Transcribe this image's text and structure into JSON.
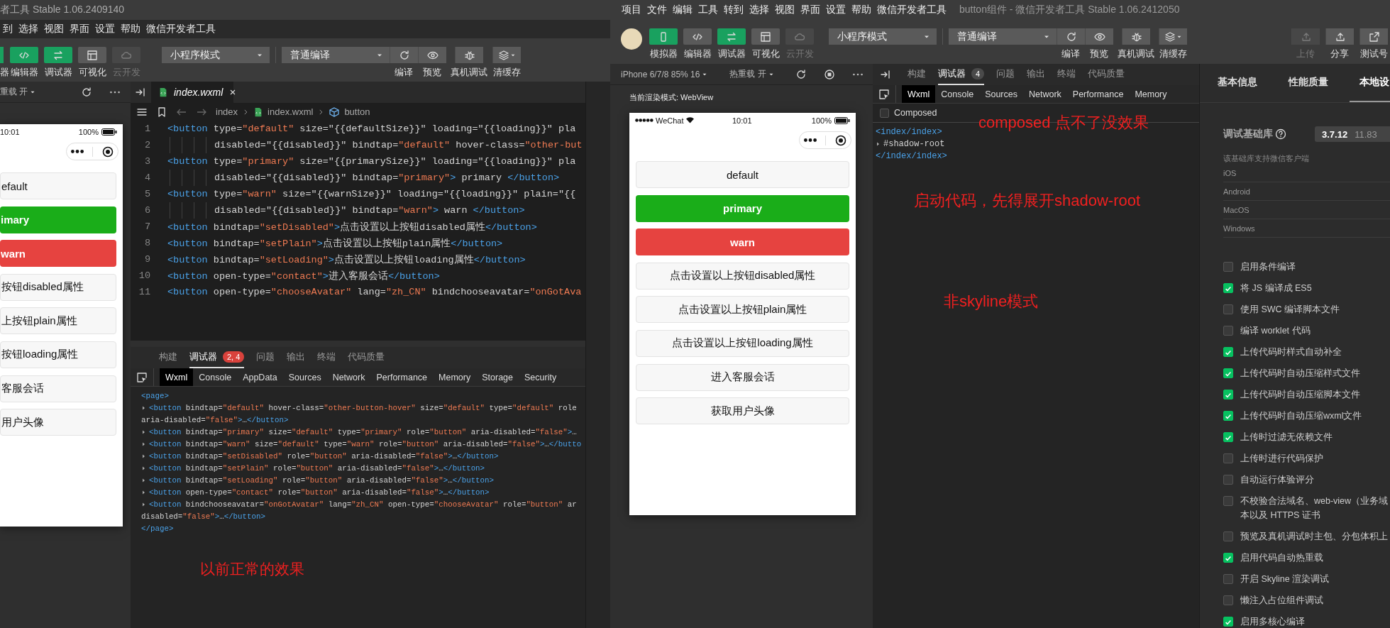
{
  "left_window": {
    "title": "者工具 Stable 1.06.2409140",
    "menu": [
      "到",
      "选择",
      "视图",
      "界面",
      "设置",
      "帮助",
      "微信开发者工具"
    ],
    "tools": [
      {
        "label": "器",
        "kind": "simulator",
        "active": true,
        "disabled": false
      },
      {
        "label": "编辑器",
        "kind": "editor",
        "active": true,
        "disabled": false
      },
      {
        "label": "调试器",
        "kind": "debugger",
        "active": true,
        "disabled": false
      },
      {
        "label": "可视化",
        "kind": "visual",
        "active": false,
        "disabled": false
      },
      {
        "label": "云开发",
        "kind": "cloud",
        "active": false,
        "disabled": true
      }
    ],
    "mode_select": "小程序模式",
    "compile_select": "普通编译",
    "actions": [
      {
        "label": "编译",
        "kind": "refresh"
      },
      {
        "label": "预览",
        "kind": "preview"
      },
      {
        "label": "真机调试",
        "kind": "debug"
      },
      {
        "label": "清缓存",
        "kind": "clear"
      }
    ],
    "sim_header": {
      "hot_reload": "重载 开"
    },
    "phone": {
      "time": "10:01",
      "battery": "100%",
      "buttons": [
        {
          "label": "efault",
          "kind": "default"
        },
        {
          "label": "imary",
          "kind": "primary"
        },
        {
          "label": "warn",
          "kind": "warn"
        },
        {
          "label": "按钮disabled属性",
          "kind": "default"
        },
        {
          "label": "上按钮plain属性",
          "kind": "default"
        },
        {
          "label": "按钮loading属性",
          "kind": "default"
        },
        {
          "label": "客服会话",
          "kind": "default"
        },
        {
          "label": "用户头像",
          "kind": "default"
        }
      ]
    },
    "editor": {
      "tab": "index.wxml",
      "breadcrumb": [
        "index",
        "index.wxml",
        "button"
      ],
      "lines": [
        {
          "number": "1",
          "code": "<button type=\"default\" size=\"{{defaultSize}}\" loading=\"{{loading}}\" pla",
          "wrapped": false
        },
        {
          "number": "2",
          "code": "disabled=\"{{disabled}}\" bindtap=\"default\" hover-class=\"other-but",
          "wrapped": true
        },
        {
          "number": "3",
          "code": "<button type=\"primary\" size=\"{{primarySize}}\" loading=\"{{loading}}\" pla",
          "wrapped": false
        },
        {
          "number": "4",
          "code": "disabled=\"{{disabled}}\" bindtap=\"primary\"> primary </button>",
          "wrapped": true
        },
        {
          "number": "5",
          "code": "<button type=\"warn\" size=\"{{warnSize}}\" loading=\"{{loading}}\" plain=\"{{",
          "wrapped": false
        },
        {
          "number": "6",
          "code": "disabled=\"{{disabled}}\" bindtap=\"warn\"> warn </button>",
          "wrapped": true
        },
        {
          "number": "7",
          "code": "<button bindtap=\"setDisabled\">点击设置以上按钮disabled属性</button>",
          "wrapped": false
        },
        {
          "number": "8",
          "code": "<button bindtap=\"setPlain\">点击设置以上按钮plain属性</button>",
          "wrapped": false
        },
        {
          "number": "9",
          "code": "<button bindtap=\"setLoading\">点击设置以上按钮loading属性</button>",
          "wrapped": false
        },
        {
          "number": "10",
          "code": "<button open-type=\"contact\">进入客服会话</button>",
          "wrapped": false
        },
        {
          "number": "11",
          "code": "<button open-type=\"chooseAvatar\" lang=\"zh_CN\" bindchooseavatar=\"onGotAva",
          "wrapped": false
        }
      ]
    },
    "devtools": {
      "tabs": [
        {
          "label": "构建",
          "selected": false
        },
        {
          "label": "调试器",
          "selected": true,
          "badge": {
            "text": "2, 4",
            "color": "#d9423c"
          }
        },
        {
          "label": "问题",
          "selected": false
        },
        {
          "label": "输出",
          "selected": false
        },
        {
          "label": "终端",
          "selected": false
        },
        {
          "label": "代码质量",
          "selected": false
        }
      ],
      "subtabs": [
        {
          "label": "Wxml",
          "selected": true
        },
        {
          "label": "Console",
          "selected": false
        },
        {
          "label": "AppData",
          "selected": false
        },
        {
          "label": "Sources",
          "selected": false
        },
        {
          "label": "Network",
          "selected": false
        },
        {
          "label": "Performance",
          "selected": false
        },
        {
          "label": "Memory",
          "selected": false
        },
        {
          "label": "Storage",
          "selected": false
        },
        {
          "label": "Security",
          "selected": false
        }
      ],
      "tree": [
        {
          "text": "<page>",
          "kind": "line"
        },
        {
          "text": "<button bindtap=\"default\" hover-class=\"other-button-hover\" size=\"default\" type=\"default\" role",
          "kind": "collapsed"
        },
        {
          "text": "aria-disabled=\"false\">…</button>",
          "kind": "line"
        },
        {
          "text": "<button bindtap=\"primary\" size=\"default\" type=\"primary\" role=\"button\" aria-disabled=\"false\">…",
          "kind": "collapsed"
        },
        {
          "text": "<button bindtap=\"warn\" size=\"default\" type=\"warn\" role=\"button\" aria-disabled=\"false\">…</butto",
          "kind": "collapsed"
        },
        {
          "text": "<button bindtap=\"setDisabled\" role=\"button\" aria-disabled=\"false\">…</button>",
          "kind": "collapsed"
        },
        {
          "text": "<button bindtap=\"setPlain\" role=\"button\" aria-disabled=\"false\">…</button>",
          "kind": "collapsed"
        },
        {
          "text": "<button bindtap=\"setLoading\" role=\"button\" aria-disabled=\"false\">…</button>",
          "kind": "collapsed"
        },
        {
          "text": "<button open-type=\"contact\" role=\"button\" aria-disabled=\"false\">…</button>",
          "kind": "collapsed"
        },
        {
          "text": "<button bindchooseavatar=\"onGotAvatar\" lang=\"zh_CN\" open-type=\"chooseAvatar\" role=\"button\" ar",
          "kind": "collapsed"
        },
        {
          "text": "disabled=\"false\">…</button>",
          "kind": "line"
        },
        {
          "text": "</page>",
          "kind": "line"
        }
      ]
    },
    "annotation": "以前正常的效果"
  },
  "right_window": {
    "menu": [
      "项目",
      "文件",
      "编辑",
      "工具",
      "转到",
      "选择",
      "视图",
      "界面",
      "设置",
      "帮助",
      "微信开发者工具"
    ],
    "title": "button组件 - 微信开发者工具 Stable 1.06.2412050",
    "tools": [
      {
        "label": "模拟器",
        "kind": "simulator",
        "active": true,
        "disabled": false
      },
      {
        "label": "编辑器",
        "kind": "editor",
        "active": false,
        "disabled": false
      },
      {
        "label": "调试器",
        "kind": "debugger",
        "active": true,
        "disabled": false
      },
      {
        "label": "可视化",
        "kind": "visual",
        "active": false,
        "disabled": false
      },
      {
        "label": "云开发",
        "kind": "cloud",
        "active": false,
        "disabled": true
      }
    ],
    "mode_select": "小程序模式",
    "compile_select": "普通编译",
    "actions": [
      {
        "label": "编译",
        "kind": "refresh"
      },
      {
        "label": "预览",
        "kind": "preview"
      },
      {
        "label": "真机调试",
        "kind": "debug"
      },
      {
        "label": "清缓存",
        "kind": "clear"
      }
    ],
    "right_actions": [
      {
        "label": "上传",
        "kind": "upload",
        "disabled": true
      },
      {
        "label": "分享",
        "kind": "share",
        "disabled": false
      },
      {
        "label": "测试号",
        "kind": "external",
        "disabled": false
      }
    ],
    "sim_header": {
      "device": "iPhone 6/7/8 85% 16",
      "hot_reload": "热重载 开"
    },
    "render_mode": "当前渲染模式: WebView",
    "phone": {
      "carrier": "WeChat",
      "time": "10:01",
      "battery": "100%",
      "buttons": [
        {
          "label": "default",
          "kind": "default"
        },
        {
          "label": "primary",
          "kind": "primary"
        },
        {
          "label": "warn",
          "kind": "warn"
        },
        {
          "label": "点击设置以上按钮disabled属性",
          "kind": "default"
        },
        {
          "label": "点击设置以上按钮plain属性",
          "kind": "default"
        },
        {
          "label": "点击设置以上按钮loading属性",
          "kind": "default"
        },
        {
          "label": "进入客服会话",
          "kind": "default"
        },
        {
          "label": "获取用户头像",
          "kind": "default"
        }
      ]
    },
    "devtools": {
      "tabs": [
        {
          "label": "构建",
          "selected": false
        },
        {
          "label": "调试器",
          "selected": true,
          "badge": {
            "text": "4",
            "color": "#4a4a4a"
          }
        },
        {
          "label": "问题",
          "selected": false
        },
        {
          "label": "输出",
          "selected": false
        },
        {
          "label": "终端",
          "selected": false
        },
        {
          "label": "代码质量",
          "selected": false
        }
      ],
      "subtabs": [
        {
          "label": "Wxml",
          "selected": true
        },
        {
          "label": "Console",
          "selected": false
        },
        {
          "label": "Sources",
          "selected": false
        },
        {
          "label": "Network",
          "selected": false
        },
        {
          "label": "Performance",
          "selected": false
        },
        {
          "label": "Memory",
          "selected": false
        }
      ],
      "composed": {
        "label": "Composed",
        "checked": false
      },
      "tree": [
        {
          "text": "<index/index>",
          "kind": "line"
        },
        {
          "text": "#shadow-root",
          "kind": "collapsed"
        },
        {
          "text": "</index/index>",
          "kind": "line"
        }
      ]
    },
    "annotations": [
      "composed 点不了没效果",
      "启动代码，先得展开shadow-root",
      "非skyline模式"
    ],
    "settings": {
      "tabs": [
        {
          "label": "基本信息",
          "selected": false
        },
        {
          "label": "性能质量",
          "selected": false
        },
        {
          "label": "本地设",
          "selected": true
        }
      ],
      "library": {
        "label": "调试基础库",
        "version": "3.7.12",
        "usage": "11.83"
      },
      "clients_label": "该基础库支持微信客户端",
      "clients": [
        "iOS",
        "Android",
        "MacOS",
        "Windows"
      ],
      "options": [
        {
          "label": "启用条件编译",
          "checked": false
        },
        {
          "label": "将 JS 编译成 ES5",
          "checked": true
        },
        {
          "label": "使用 SWC 编译脚本文件",
          "checked": false
        },
        {
          "label": "编译 worklet 代码",
          "checked": false
        },
        {
          "label": "上传代码时样式自动补全",
          "checked": true
        },
        {
          "label": "上传代码时自动压缩样式文件",
          "checked": true
        },
        {
          "label": "上传代码时自动压缩脚本文件",
          "checked": true
        },
        {
          "label": "上传代码时自动压缩wxml文件",
          "checked": true
        },
        {
          "label": "上传时过滤无依赖文件",
          "checked": true
        },
        {
          "label": "上传时进行代码保护",
          "checked": false
        },
        {
          "label": "自动运行体验评分",
          "checked": false
        },
        {
          "label": "不校验合法域名、web-view（业务域",
          "continuation": "本以及 HTTPS 证书",
          "checked": false
        },
        {
          "label": "预览及真机调试时主包、分包体积上",
          "checked": false
        },
        {
          "label": "启用代码自动热重载",
          "checked": true
        },
        {
          "label": "开启 Skyline 渲染调试",
          "checked": false
        },
        {
          "label": "懒注入占位组件调试",
          "checked": false
        },
        {
          "label": "启用多核心编译",
          "checked": true
        }
      ]
    }
  }
}
